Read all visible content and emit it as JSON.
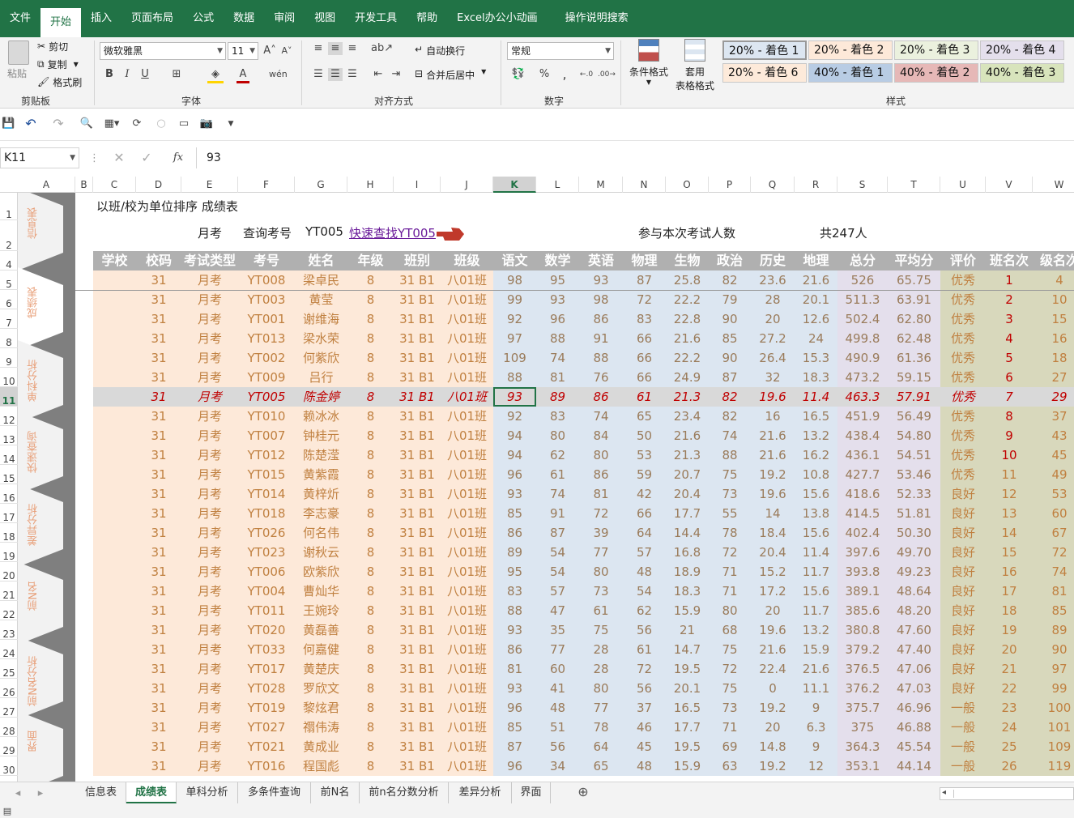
{
  "menu": [
    "文件",
    "开始",
    "插入",
    "页面布局",
    "公式",
    "数据",
    "审阅",
    "视图",
    "开发工具",
    "帮助",
    "Excel办公小动画",
    "操作说明搜索"
  ],
  "ribbon": {
    "clipboard": {
      "paste": "粘贴",
      "cut": "剪切",
      "copy": "复制",
      "format_painter": "格式刷",
      "label": "剪贴板"
    },
    "font": {
      "name": "微软雅黑",
      "size": "11",
      "bold": "B",
      "italic": "I",
      "underline": "U",
      "label": "字体"
    },
    "align": {
      "wrap": "自动换行",
      "merge": "合并后居中",
      "label": "对齐方式"
    },
    "number": {
      "format": "常规",
      "percent": "%",
      "label": "数字"
    },
    "styles": {
      "cond_format": "条件格式",
      "table_format_1": "套用",
      "table_format_2": "表格格式",
      "label": "样式",
      "cells": [
        {
          "text": "20% - 着色 1",
          "bg": "#dce6f1"
        },
        {
          "text": "20% - 着色 2",
          "bg": "#fde9d9"
        },
        {
          "text": "20% - 着色 3",
          "bg": "#ebf1de"
        },
        {
          "text": "20% - 着色 4",
          "bg": "#e4dfec"
        },
        {
          "text": "20% - 着色 6",
          "bg": "#fdeada"
        },
        {
          "text": "40% - 着色 1",
          "bg": "#b8cce4"
        },
        {
          "text": "40% - 着色 2",
          "bg": "#e6b8b7"
        },
        {
          "text": "40% - 着色 3",
          "bg": "#d8e4bc"
        }
      ]
    }
  },
  "formula": {
    "cell_ref": "K11",
    "value": "93",
    "fx": "fx"
  },
  "columns": [
    "A",
    "B",
    "C",
    "D",
    "E",
    "F",
    "G",
    "H",
    "I",
    "J",
    "K",
    "L",
    "M",
    "N",
    "O",
    "P",
    "Q",
    "R",
    "S",
    "T",
    "U",
    "V",
    "W"
  ],
  "rows": [
    "1",
    "2",
    "4",
    "5",
    "6",
    "7",
    "8",
    "9",
    "10",
    "11",
    "12",
    "13",
    "14",
    "15",
    "16",
    "17",
    "18",
    "19",
    "20",
    "21",
    "22",
    "23",
    "24",
    "25",
    "26",
    "27",
    "28",
    "29",
    "30"
  ],
  "side_nav": [
    "信息表",
    "成绩表",
    "单科分析",
    "快速查询",
    "差异分析",
    "前N名",
    "前N名分析",
    "界面"
  ],
  "sheet": {
    "title": "以班/校为单位排序 成绩表",
    "exam_type": "月考",
    "query_label": "查询考号",
    "query_value": "YT005",
    "quick_link": "快速查找YT005",
    "participants_label": "参与本次考试人数",
    "participants_value": "共247人",
    "headers": [
      "学校",
      "校码",
      "考试类型",
      "考号",
      "姓名",
      "年级",
      "班别",
      "班级",
      "语文",
      "数学",
      "英语",
      "物理",
      "生物",
      "政治",
      "历史",
      "地理",
      "总分",
      "平均分",
      "评价",
      "班名次",
      "级名次"
    ],
    "data": [
      [
        "",
        "31",
        "月考",
        "YT008",
        "梁卓民",
        "8",
        "31 B1",
        "八01班",
        "98",
        "95",
        "93",
        "87",
        "25.8",
        "82",
        "23.6",
        "21.6",
        "526",
        "65.75",
        "优秀",
        "1",
        "4"
      ],
      [
        "",
        "31",
        "月考",
        "YT003",
        "黄莹",
        "8",
        "31 B1",
        "八01班",
        "99",
        "93",
        "98",
        "72",
        "22.2",
        "79",
        "28",
        "20.1",
        "511.3",
        "63.91",
        "优秀",
        "2",
        "10"
      ],
      [
        "",
        "31",
        "月考",
        "YT001",
        "谢维海",
        "8",
        "31 B1",
        "八01班",
        "92",
        "96",
        "86",
        "83",
        "22.8",
        "90",
        "20",
        "12.6",
        "502.4",
        "62.80",
        "优秀",
        "3",
        "15"
      ],
      [
        "",
        "31",
        "月考",
        "YT013",
        "梁水荣",
        "8",
        "31 B1",
        "八01班",
        "97",
        "88",
        "91",
        "66",
        "21.6",
        "85",
        "27.2",
        "24",
        "499.8",
        "62.48",
        "优秀",
        "4",
        "16"
      ],
      [
        "",
        "31",
        "月考",
        "YT002",
        "何紫欣",
        "8",
        "31 B1",
        "八01班",
        "109",
        "74",
        "88",
        "66",
        "22.2",
        "90",
        "26.4",
        "15.3",
        "490.9",
        "61.36",
        "优秀",
        "5",
        "18"
      ],
      [
        "",
        "31",
        "月考",
        "YT009",
        "吕行",
        "8",
        "31 B1",
        "八01班",
        "88",
        "81",
        "76",
        "66",
        "24.9",
        "87",
        "32",
        "18.3",
        "473.2",
        "59.15",
        "优秀",
        "6",
        "27"
      ],
      [
        "",
        "31",
        "月考",
        "YT005",
        "陈金婷",
        "8",
        "31 B1",
        "八01班",
        "93",
        "89",
        "86",
        "61",
        "21.3",
        "82",
        "19.6",
        "11.4",
        "463.3",
        "57.91",
        "优秀",
        "7",
        "29"
      ],
      [
        "",
        "31",
        "月考",
        "YT010",
        "赖冰冰",
        "8",
        "31 B1",
        "八01班",
        "92",
        "83",
        "74",
        "65",
        "23.4",
        "82",
        "16",
        "16.5",
        "451.9",
        "56.49",
        "优秀",
        "8",
        "37"
      ],
      [
        "",
        "31",
        "月考",
        "YT007",
        "钟桂元",
        "8",
        "31 B1",
        "八01班",
        "94",
        "80",
        "84",
        "50",
        "21.6",
        "74",
        "21.6",
        "13.2",
        "438.4",
        "54.80",
        "优秀",
        "9",
        "43"
      ],
      [
        "",
        "31",
        "月考",
        "YT012",
        "陈楚滢",
        "8",
        "31 B1",
        "八01班",
        "94",
        "62",
        "80",
        "53",
        "21.3",
        "88",
        "21.6",
        "16.2",
        "436.1",
        "54.51",
        "优秀",
        "10",
        "45"
      ],
      [
        "",
        "31",
        "月考",
        "YT015",
        "黄紫霞",
        "8",
        "31 B1",
        "八01班",
        "96",
        "61",
        "86",
        "59",
        "20.7",
        "75",
        "19.2",
        "10.8",
        "427.7",
        "53.46",
        "优秀",
        "11",
        "49"
      ],
      [
        "",
        "31",
        "月考",
        "YT014",
        "黄梓炘",
        "8",
        "31 B1",
        "八01班",
        "93",
        "74",
        "81",
        "42",
        "20.4",
        "73",
        "19.6",
        "15.6",
        "418.6",
        "52.33",
        "良好",
        "12",
        "53"
      ],
      [
        "",
        "31",
        "月考",
        "YT018",
        "李志豪",
        "8",
        "31 B1",
        "八01班",
        "85",
        "91",
        "72",
        "66",
        "17.7",
        "55",
        "14",
        "13.8",
        "414.5",
        "51.81",
        "良好",
        "13",
        "60"
      ],
      [
        "",
        "31",
        "月考",
        "YT026",
        "何名伟",
        "8",
        "31 B1",
        "八01班",
        "86",
        "87",
        "39",
        "64",
        "14.4",
        "78",
        "18.4",
        "15.6",
        "402.4",
        "50.30",
        "良好",
        "14",
        "67"
      ],
      [
        "",
        "31",
        "月考",
        "YT023",
        "谢秋云",
        "8",
        "31 B1",
        "八01班",
        "89",
        "54",
        "77",
        "57",
        "16.8",
        "72",
        "20.4",
        "11.4",
        "397.6",
        "49.70",
        "良好",
        "15",
        "72"
      ],
      [
        "",
        "31",
        "月考",
        "YT006",
        "欧紫欣",
        "8",
        "31 B1",
        "八01班",
        "95",
        "54",
        "80",
        "48",
        "18.9",
        "71",
        "15.2",
        "11.7",
        "393.8",
        "49.23",
        "良好",
        "16",
        "74"
      ],
      [
        "",
        "31",
        "月考",
        "YT004",
        "曹灿华",
        "8",
        "31 B1",
        "八01班",
        "83",
        "57",
        "73",
        "54",
        "18.3",
        "71",
        "17.2",
        "15.6",
        "389.1",
        "48.64",
        "良好",
        "17",
        "81"
      ],
      [
        "",
        "31",
        "月考",
        "YT011",
        "王婉玲",
        "8",
        "31 B1",
        "八01班",
        "88",
        "47",
        "61",
        "62",
        "15.9",
        "80",
        "20",
        "11.7",
        "385.6",
        "48.20",
        "良好",
        "18",
        "85"
      ],
      [
        "",
        "31",
        "月考",
        "YT020",
        "黄磊善",
        "8",
        "31 B1",
        "八01班",
        "93",
        "35",
        "75",
        "56",
        "21",
        "68",
        "19.6",
        "13.2",
        "380.8",
        "47.60",
        "良好",
        "19",
        "89"
      ],
      [
        "",
        "31",
        "月考",
        "YT033",
        "何嘉健",
        "8",
        "31 B1",
        "八01班",
        "86",
        "77",
        "28",
        "61",
        "14.7",
        "75",
        "21.6",
        "15.9",
        "379.2",
        "47.40",
        "良好",
        "20",
        "90"
      ],
      [
        "",
        "31",
        "月考",
        "YT017",
        "黄楚庆",
        "8",
        "31 B1",
        "八01班",
        "81",
        "60",
        "28",
        "72",
        "19.5",
        "72",
        "22.4",
        "21.6",
        "376.5",
        "47.06",
        "良好",
        "21",
        "97"
      ],
      [
        "",
        "31",
        "月考",
        "YT028",
        "罗欣文",
        "8",
        "31 B1",
        "八01班",
        "93",
        "41",
        "80",
        "56",
        "20.1",
        "75",
        "0",
        "11.1",
        "376.2",
        "47.03",
        "良好",
        "22",
        "99"
      ],
      [
        "",
        "31",
        "月考",
        "YT019",
        "黎炫君",
        "8",
        "31 B1",
        "八01班",
        "96",
        "48",
        "77",
        "37",
        "16.5",
        "73",
        "19.2",
        "9",
        "375.7",
        "46.96",
        "一般",
        "23",
        "100"
      ],
      [
        "",
        "31",
        "月考",
        "YT027",
        "禤伟涛",
        "8",
        "31 B1",
        "八01班",
        "85",
        "51",
        "78",
        "46",
        "17.7",
        "71",
        "20",
        "6.3",
        "375",
        "46.88",
        "一般",
        "24",
        "101"
      ],
      [
        "",
        "31",
        "月考",
        "YT021",
        "黄成业",
        "8",
        "31 B1",
        "八01班",
        "87",
        "56",
        "64",
        "45",
        "19.5",
        "69",
        "14.8",
        "9",
        "364.3",
        "45.54",
        "一般",
        "25",
        "109"
      ],
      [
        "",
        "31",
        "月考",
        "YT016",
        "程国彪",
        "8",
        "31 B1",
        "八01班",
        "96",
        "34",
        "65",
        "48",
        "15.9",
        "63",
        "19.2",
        "12",
        "353.1",
        "44.14",
        "一般",
        "26",
        "119"
      ]
    ]
  },
  "tabs": [
    "信息表",
    "成绩表",
    "单科分析",
    "多条件查询",
    "前N名",
    "前n名分数分析",
    "差异分析",
    "界面"
  ],
  "active_tab": "成绩表",
  "colors": {
    "accent": "#217346",
    "peach": "#fde9d9",
    "blue": "#dce6f1",
    "lavender": "#e4dfec",
    "olive": "#d8d8bc",
    "text_orange": "#c08040",
    "red": "#c00000"
  }
}
